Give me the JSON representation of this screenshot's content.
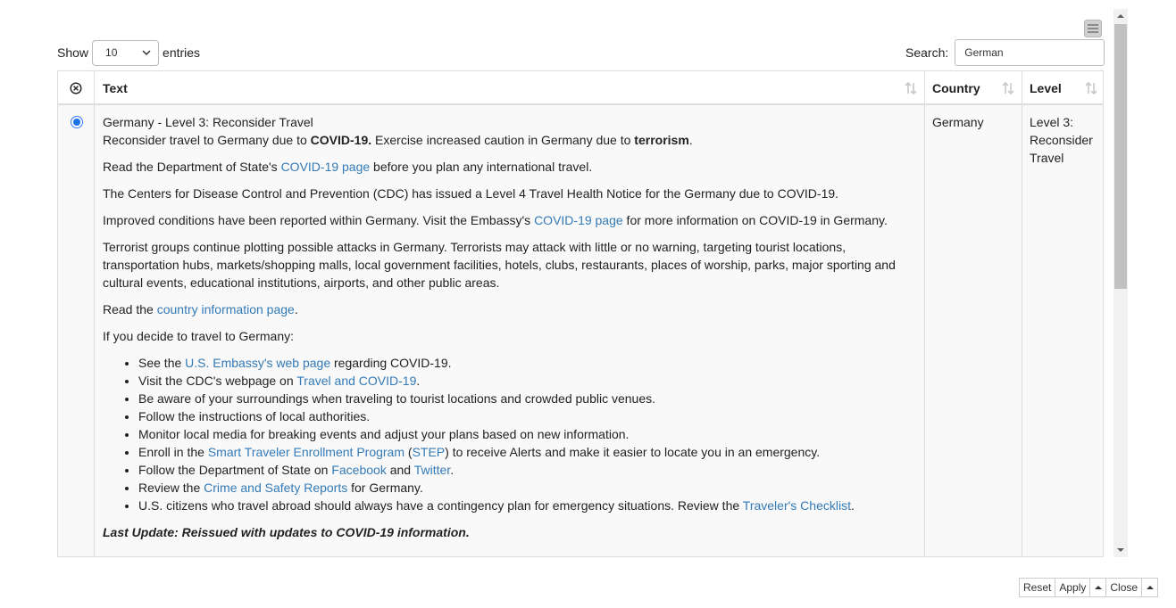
{
  "controls": {
    "show_label": "Show",
    "entries_value": "10",
    "entries_label": "entries",
    "search_label": "Search:",
    "search_value": "German"
  },
  "table": {
    "columns": [
      "Text",
      "Country",
      "Level"
    ],
    "row": {
      "title": "Germany - Level 3: Reconsider Travel",
      "intro_a": "Reconsider travel to Germany due to ",
      "intro_covid": "COVID-19.",
      "intro_b": " Exercise increased caution in Germany due to ",
      "intro_terror": "terrorism",
      "intro_c": ".",
      "p1_a": "Read the Department of State's ",
      "p1_link": "COVID-19 page",
      "p1_b": " before you plan any international travel.",
      "p2": "The Centers for Disease Control and Prevention (CDC) has issued a Level 4 Travel Health Notice for the Germany due to COVID-19.",
      "p3_a": "Improved conditions have been reported within Germany. Visit the Embassy's ",
      "p3_link": "COVID-19 page",
      "p3_b": " for more information on COVID-19 in Germany.",
      "p4": "Terrorist groups continue plotting possible attacks in Germany. Terrorists may attack with little or no warning, targeting tourist locations, transportation hubs, markets/shopping malls, local government facilities, hotels, clubs, restaurants, places of worship, parks, major sporting and cultural events, educational institutions, airports, and other public areas.",
      "p5_a": "Read the ",
      "p5_link": "country information page",
      "p5_b": ".",
      "p6": "If you decide to travel to Germany:",
      "li1_a": "See the ",
      "li1_link": "U.S. Embassy's web page",
      "li1_b": " regarding COVID-19.",
      "li2_a": "Visit the CDC's webpage on ",
      "li2_link": "Travel and COVID-19",
      "li2_b": ".",
      "li3": "Be aware of your surroundings when traveling to tourist locations and crowded public venues.",
      "li4": "Follow the instructions of local authorities.",
      "li5": "Monitor local media for breaking events and adjust your plans based on new information.",
      "li6_a": "Enroll in the ",
      "li6_link1": "Smart Traveler Enrollment Program",
      "li6_b": " (",
      "li6_link2": "STEP",
      "li6_c": ") to receive Alerts and make it easier to locate you in an emergency.",
      "li7_a": "Follow the Department of State on ",
      "li7_link1": "Facebook",
      "li7_b": " and ",
      "li7_link2": "Twitter",
      "li7_c": ".",
      "li8_a": "Review the ",
      "li8_link": "Crime and Safety Reports",
      "li8_b": " for Germany.",
      "li9_a": "U.S. citizens who travel abroad should always have a contingency plan for emergency situations. Review the ",
      "li9_link": "Traveler's Checklist",
      "li9_b": ".",
      "last_update": "Last Update: Reissued with updates to COVID-19 information.",
      "country": "Germany",
      "level": "Level 3: Reconsider Travel"
    }
  },
  "buttons": {
    "reset": "Reset",
    "apply": "Apply",
    "close": "Close"
  },
  "icons": {
    "menu": "hamburger-menu-icon",
    "deselect": "circle-x-icon",
    "sort": "sort-arrows-icon",
    "select": "select-chevron-icon",
    "caret": "caret-up-icon"
  },
  "colors": {
    "link": "#337ab7",
    "radio": "#1a73e8",
    "row_bg": "#f9f9f9",
    "border": "#dddddd"
  }
}
